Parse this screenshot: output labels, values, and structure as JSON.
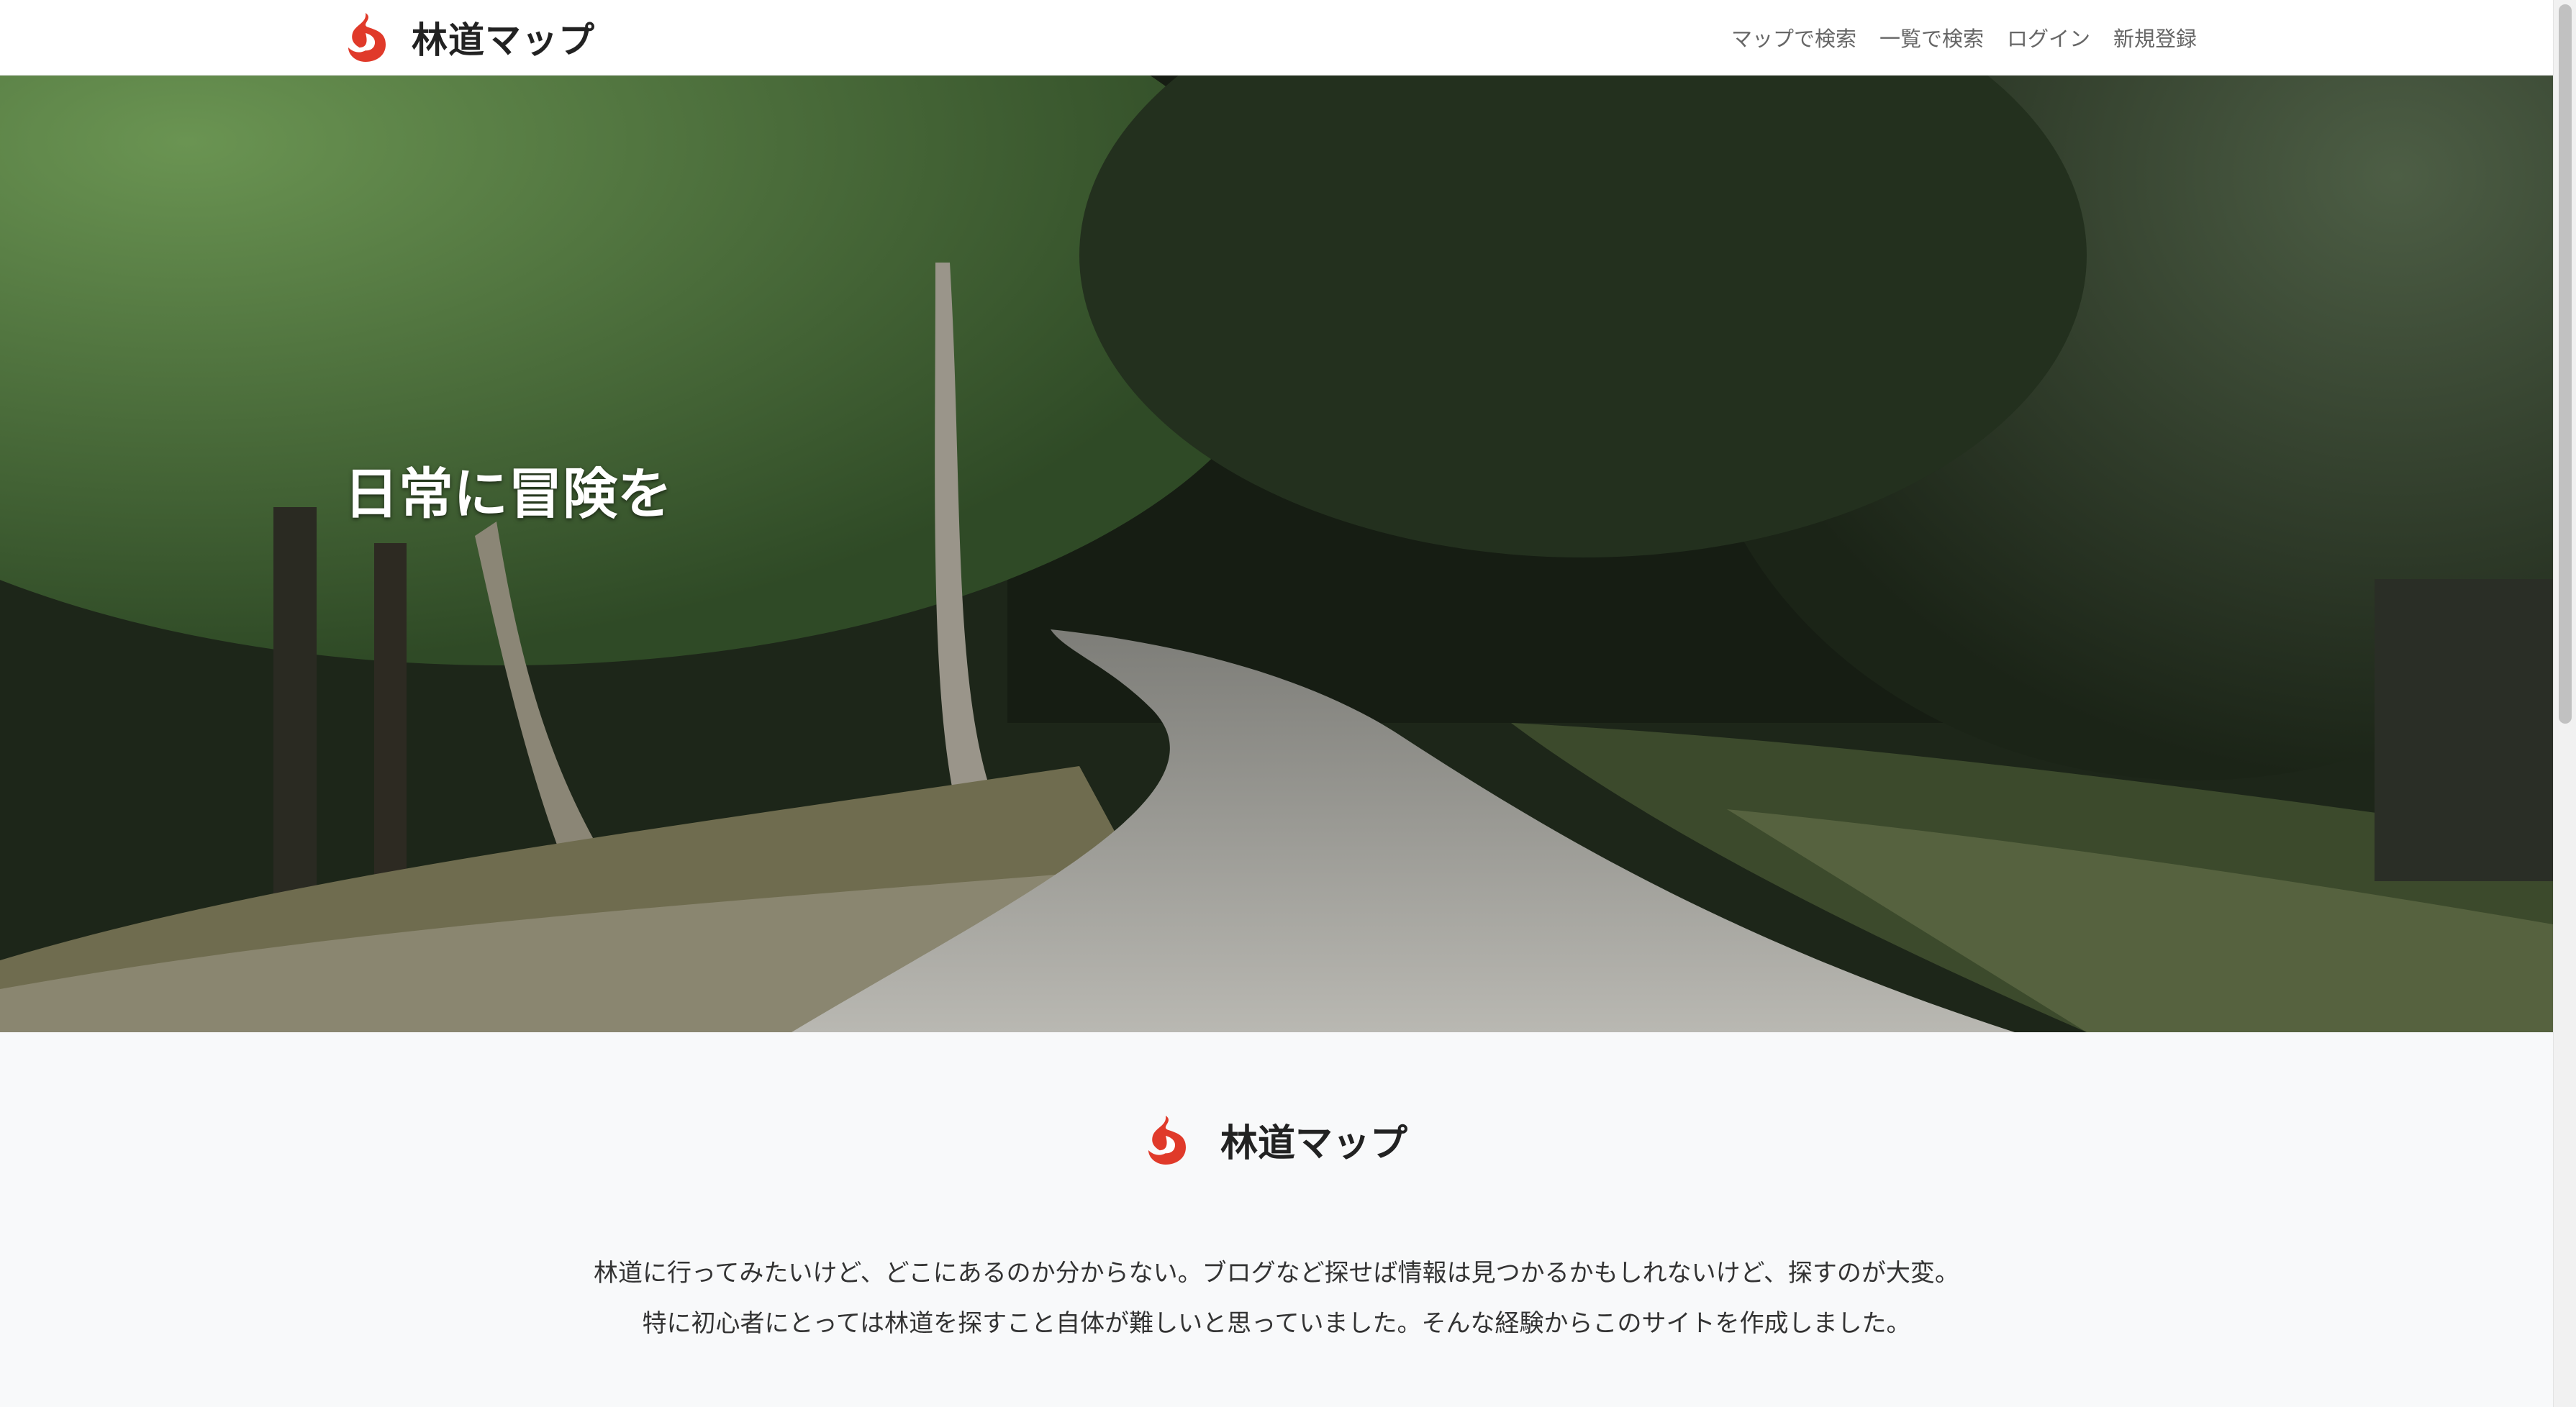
{
  "site": {
    "brand_name": "林道マップ",
    "brand_icon": "flame-logo-icon",
    "accent_color": "#e03a2a"
  },
  "nav": {
    "items": [
      {
        "label": "マップで検索"
      },
      {
        "label": "一覧で検索"
      },
      {
        "label": "ログイン"
      },
      {
        "label": "新規登録"
      }
    ]
  },
  "hero": {
    "title": "日常に冒険を"
  },
  "about": {
    "brand_name": "林道マップ",
    "lines": [
      "林道に行ってみたいけど、どこにあるのか分からない。ブログなど探せば情報は見つかるかもしれないけど、探すのが大変。",
      "特に初心者にとっては林道を探すこと自体が難しいと思っていました。そんな経験からこのサイトを作成しました。"
    ]
  }
}
